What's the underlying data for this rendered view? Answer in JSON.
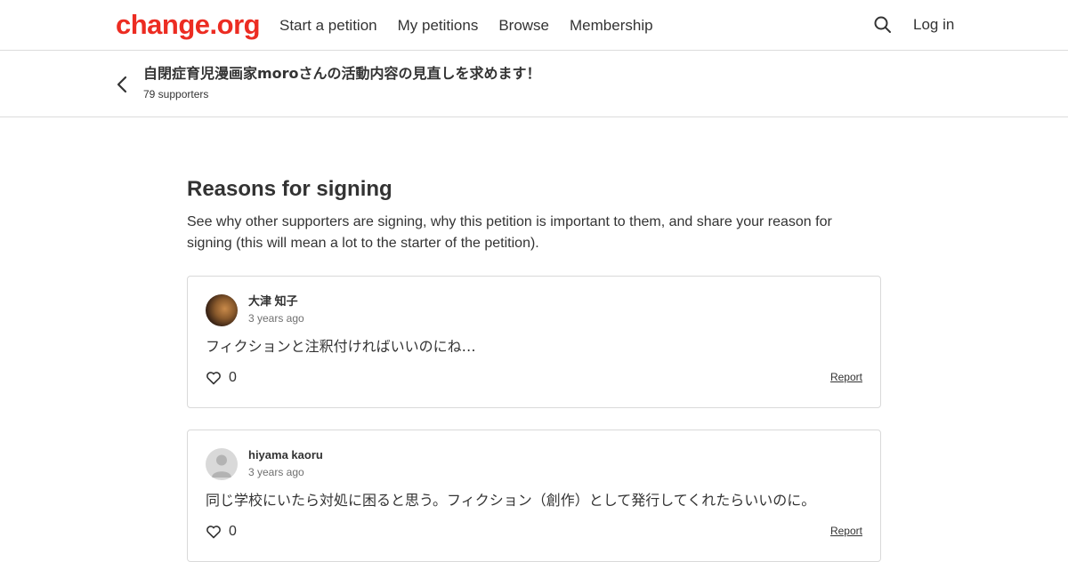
{
  "header": {
    "logo": "change.org",
    "nav": [
      "Start a petition",
      "My petitions",
      "Browse",
      "Membership"
    ],
    "login": "Log in"
  },
  "petition": {
    "title": "自閉症育児漫画家moroさんの活動内容の見直しを求めます！",
    "supporters": "79 supporters"
  },
  "reasons": {
    "heading": "Reasons for signing",
    "description": "See why other supporters are signing, why this petition is important to them, and share your reason for signing (this will mean a lot to the starter of the petition)."
  },
  "comments": [
    {
      "author": "大津 知子",
      "time": "3 years ago",
      "text": "フィクションと注釈付ければいいのにね…",
      "likes": "0",
      "report": "Report",
      "avatar": "photo"
    },
    {
      "author": "hiyama kaoru",
      "time": "3 years ago",
      "text": "同じ学校にいたら対処に困ると思う。フィクション（創作）として発行してくれたらいいのに。",
      "likes": "0",
      "report": "Report",
      "avatar": "default-avatar-icon"
    }
  ],
  "colors": {
    "brand": "#ec2c22",
    "text": "#333333",
    "border": "#d9d9d9"
  }
}
